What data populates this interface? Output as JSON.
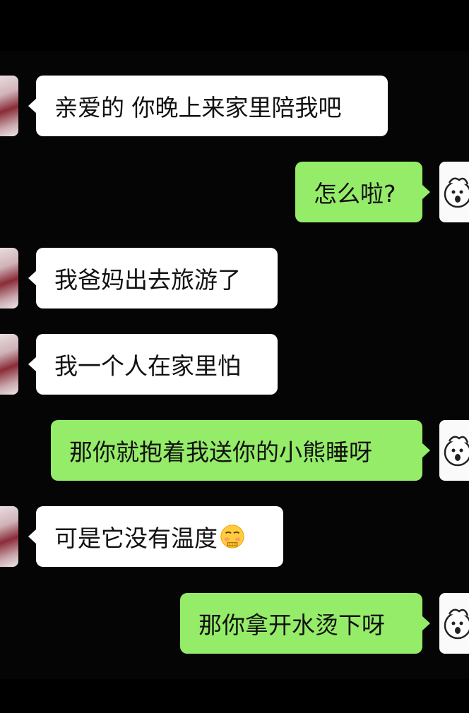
{
  "messages": [
    {
      "side": "in",
      "text": "亲爱的 你晚上来家里陪我吧"
    },
    {
      "side": "out",
      "text": "怎么啦?"
    },
    {
      "side": "in",
      "text": "我爸妈出去旅游了"
    },
    {
      "side": "in",
      "text": "我一个人在家里怕"
    },
    {
      "side": "out",
      "text": "那你就抱着我送你的小熊睡呀"
    },
    {
      "side": "in",
      "text": "可是它没有温度",
      "emoji": "cold-face-emoji"
    },
    {
      "side": "out",
      "text": "那你拿开水烫下呀"
    }
  ],
  "colors": {
    "incoming_bubble": "#ffffff",
    "outgoing_bubble": "#95ec69",
    "background": "#050505"
  },
  "icons": {
    "contact_avatar": "photo-avatar",
    "self_avatar": "cartoon-sheep-avatar"
  }
}
